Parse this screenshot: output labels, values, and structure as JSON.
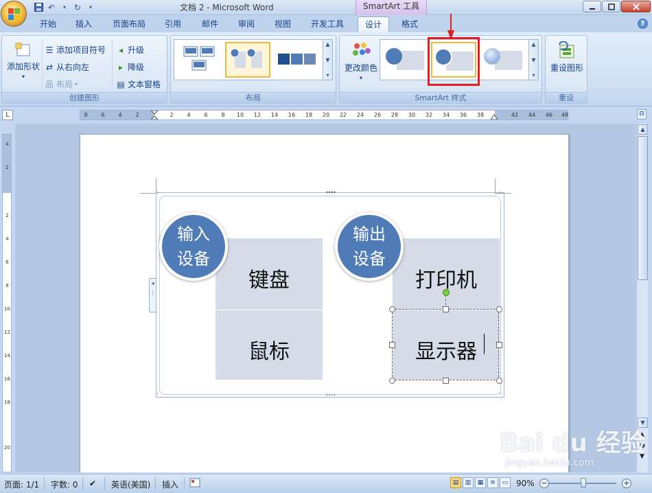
{
  "window": {
    "title": "文档 2 - Microsoft Word",
    "context_tool": "SmartArt 工具"
  },
  "tabs": [
    {
      "label": "开始"
    },
    {
      "label": "插入"
    },
    {
      "label": "页面布局"
    },
    {
      "label": "引用"
    },
    {
      "label": "邮件"
    },
    {
      "label": "审阅"
    },
    {
      "label": "视图"
    },
    {
      "label": "开发工具"
    },
    {
      "label": "设计",
      "active": true
    },
    {
      "label": "格式"
    }
  ],
  "ribbon": {
    "create_graphic": {
      "label": "创建图形",
      "add_shape": "添加形状",
      "add_bullet": "添加项目符号",
      "right_to_left": "从右向左",
      "layout": "布局",
      "promote": "升级",
      "demote": "降级",
      "text_pane": "文本窗格"
    },
    "layouts": {
      "label": "布局"
    },
    "styles": {
      "label": "SmartArt 样式",
      "change_colors": "更改颜色"
    },
    "reset": {
      "label": "重设",
      "reset_graphic": "重设图形"
    }
  },
  "ruler": {
    "horizontal_ticks": [
      "8",
      "6",
      "4",
      "2",
      "2",
      "4",
      "6",
      "8",
      "10",
      "12",
      "14",
      "16",
      "18",
      "20",
      "22",
      "24",
      "26",
      "28",
      "30",
      "32",
      "34",
      "36",
      "38",
      "42",
      "44",
      "46",
      "48"
    ],
    "vertical_ticks": [
      "4",
      "2",
      "2",
      "4",
      "6",
      "8",
      "10",
      "12",
      "14",
      "16",
      "18",
      "20"
    ]
  },
  "smartart": {
    "groups": [
      {
        "heading": "输入\n设备",
        "items": [
          "键盘",
          "鼠标"
        ]
      },
      {
        "heading": "输出\n设备",
        "items": [
          "打印机",
          "显示器"
        ]
      }
    ]
  },
  "status": {
    "page": "页面: 1/1",
    "words": "字数: 0",
    "language": "英语(美国)",
    "mode": "插入",
    "zoom": "90%"
  },
  "watermark": {
    "logo": "Bai du 经验",
    "url": "jingyan.baidu.com"
  },
  "colors": {
    "accent_circle": "#4f7cb6",
    "box_fill": "#d5dbe7",
    "highlight": "#e02020"
  }
}
